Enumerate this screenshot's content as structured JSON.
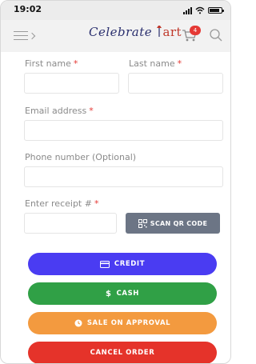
{
  "status_bar": {
    "time": "19:02"
  },
  "header": {
    "logo_text": "Celebrate",
    "logo_suffix": "art",
    "cart_count": "4"
  },
  "form": {
    "first_name": {
      "label": "First name",
      "required": "*",
      "value": ""
    },
    "last_name": {
      "label": "Last name",
      "required": "*",
      "value": ""
    },
    "email": {
      "label": "Email address",
      "required": "*",
      "value": ""
    },
    "phone": {
      "label": "Phone number (Optional)",
      "value": ""
    },
    "receipt": {
      "label": "Enter receipt #",
      "required": "*",
      "value": ""
    }
  },
  "buttons": {
    "scan_qr": "SCAN QR CODE",
    "credit": "CREDIT",
    "cash": "CASH",
    "sale_on_approval": "SALE ON APPROVAL",
    "cancel_order": "CANCEL ORDER"
  },
  "colors": {
    "credit": "#4a3cf2",
    "cash": "#30a046",
    "approval": "#f39a3f",
    "cancel": "#e5332a",
    "scan": "#6c7585",
    "required": "#e53935"
  }
}
